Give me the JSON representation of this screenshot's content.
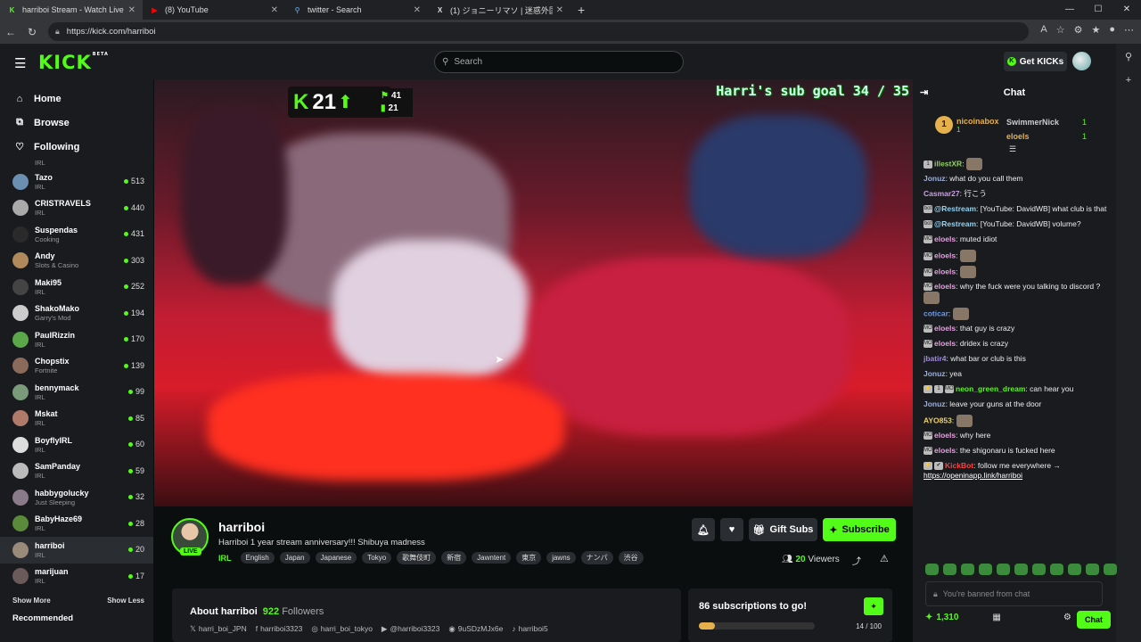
{
  "browser": {
    "tabs": [
      {
        "title": "harriboi Stream - Watch Live",
        "fav": "K",
        "fav_color": "#53fc18",
        "active": true
      },
      {
        "title": "(8) YouTube",
        "fav": "▶",
        "fav_color": "#ff0000",
        "active": false
      },
      {
        "title": "twitter - Search",
        "fav": "⚲",
        "fav_color": "#4a90d9",
        "active": false
      },
      {
        "title": "(1) ジョニーリマソ | 迷惑外国人撲滅",
        "fav": "X",
        "fav_color": "#dddddd",
        "active": false
      }
    ],
    "url": "https://kick.com/harriboi"
  },
  "header": {
    "logo": "KICK",
    "logo_beta": "BETA",
    "search_placeholder": "Search",
    "get_kicks_label": "Get KICKs"
  },
  "sidebar": {
    "nav": [
      {
        "label": "Home",
        "icon": "⌂"
      },
      {
        "label": "Browse",
        "icon": "⧉"
      },
      {
        "label": "Following",
        "icon": "♡"
      }
    ],
    "partial_category": "IRL",
    "channels": [
      {
        "name": "Tazo",
        "category": "IRL",
        "viewers": "513",
        "color": "#6a8fb0"
      },
      {
        "name": "CRISTRAVELS",
        "category": "IRL",
        "viewers": "440",
        "color": "#aaaaaa"
      },
      {
        "name": "Suspendas",
        "category": "Cooking",
        "viewers": "431",
        "color": "#2a2a2a"
      },
      {
        "name": "Andy",
        "category": "Slots & Casino",
        "viewers": "303",
        "color": "#b08a5a"
      },
      {
        "name": "Maki95",
        "category": "IRL",
        "viewers": "252",
        "color": "#444444"
      },
      {
        "name": "ShakoMako",
        "category": "Garry's Mod",
        "viewers": "194",
        "color": "#cccccc"
      },
      {
        "name": "PaulRizzin",
        "category": "IRL",
        "viewers": "170",
        "color": "#5aa84a"
      },
      {
        "name": "Chopstix",
        "category": "Fortnite",
        "viewers": "139",
        "color": "#8a6a5a"
      },
      {
        "name": "bennymack",
        "category": "IRL",
        "viewers": "99",
        "color": "#7a9a7a"
      },
      {
        "name": "Mskat",
        "category": "IRL",
        "viewers": "85",
        "color": "#b07a6a"
      },
      {
        "name": "BoyflyIRL",
        "category": "IRL",
        "viewers": "60",
        "color": "#dddddd"
      },
      {
        "name": "SamPanday",
        "category": "IRL",
        "viewers": "59",
        "color": "#bbbbbb"
      },
      {
        "name": "habbygolucky",
        "category": "Just Sleeping",
        "viewers": "32",
        "color": "#8a7a8a"
      },
      {
        "name": "BabyHaze69",
        "category": "IRL",
        "viewers": "28",
        "color": "#5a8a3a"
      },
      {
        "name": "harriboi",
        "category": "IRL",
        "viewers": "20",
        "color": "#9a8a7a",
        "selected": true
      },
      {
        "name": "marijuan",
        "category": "IRL",
        "viewers": "17",
        "color": "#6a5a5a"
      }
    ],
    "show_more": "Show More",
    "show_less": "Show Less",
    "recommended": "Recommended"
  },
  "video": {
    "kick_count": "21",
    "counter_top": "41",
    "counter_bottom": "21",
    "sub_goal": "Harri's sub goal 34 / 35"
  },
  "stream": {
    "streamer": "harriboi",
    "live_badge": "LIVE",
    "title": "Harriboi 1 year stream anniversary!!! Shibuya madness",
    "category": "IRL",
    "tags": [
      "English",
      "Japan",
      "Japanese",
      "Tokyo",
      "歌舞伎町",
      "新宿",
      "Jawntent",
      "東京",
      "jawns",
      "ナンパ",
      "渋谷"
    ],
    "gift_subs_label": "Gift Subs",
    "subscribe_label": "Subscribe",
    "viewers_count": "20",
    "viewers_label": "Viewers",
    "about_title": "About harriboi",
    "followers_count": "922",
    "followers_label": "Followers",
    "socials": [
      "harri_boi_JPN",
      "harriboi3323",
      "harri_boi_tokyo",
      "@harriboi3323",
      "9uSDzMJx6e",
      "harriboi5"
    ],
    "subs_to_go": "86 subscriptions to go!",
    "subs_progress_text": "14 / 100",
    "subs_progress": 0.14
  },
  "chat": {
    "title": "Chat",
    "top_gifter": {
      "rank": "1",
      "name": "nicoinabox",
      "count": "1"
    },
    "gifters": [
      {
        "name": "SwimmerNick",
        "count": "1",
        "color": "#cccccc"
      },
      {
        "name": "eloels",
        "count": "1",
        "color": "#e6b04c"
      }
    ],
    "messages": [
      {
        "badges": [
          "1"
        ],
        "user": "illestXR",
        "color": "#8fd35a",
        "text": "",
        "emote": true
      },
      {
        "badges": [],
        "user": "Jonuz",
        "color": "#9ab0e0",
        "text": "what do you call them"
      },
      {
        "badges": [],
        "user": "Casmar27",
        "color": "#c8a0e0",
        "text": "行こう"
      },
      {
        "badges": [
          "bot"
        ],
        "user": "@Restream",
        "color": "#8fd3f5",
        "text": "[YouTube: DavidWB] what club is that"
      },
      {
        "badges": [
          "bot"
        ],
        "user": "@Restream",
        "color": "#8fd3f5",
        "text": "[YouTube: DavidWB] volume?"
      },
      {
        "badges": [
          "MOD"
        ],
        "user": "eloels",
        "color": "#e6a0e0",
        "text": "muted idiot"
      },
      {
        "badges": [
          "MOD"
        ],
        "user": "eloels",
        "color": "#e6a0e0",
        "text": "",
        "emote": true
      },
      {
        "badges": [
          "MOD"
        ],
        "user": "eloels",
        "color": "#e6a0e0",
        "text": "",
        "emote": true
      },
      {
        "badges": [
          "MOD"
        ],
        "user": "eloels",
        "color": "#e6a0e0",
        "text": "why the fuck were you talking to discord ?",
        "emote": true
      },
      {
        "badges": [],
        "user": "coticar",
        "color": "#6a9af0",
        "text": "",
        "emote": true
      },
      {
        "badges": [
          "MOD"
        ],
        "user": "eloels",
        "color": "#e6a0e0",
        "text": "that guy is crazy"
      },
      {
        "badges": [
          "MOD"
        ],
        "user": "eloels",
        "color": "#e6a0e0",
        "text": "dridex is crazy"
      },
      {
        "badges": [],
        "user": "jbatir4",
        "color": "#a08ae0",
        "text": "what bar or club is this"
      },
      {
        "badges": [],
        "user": "Jonuz",
        "color": "#9ab0e0",
        "text": "yea"
      },
      {
        "badges": [
          "⚡",
          "1",
          "MOD"
        ],
        "user": "neon_green_dream",
        "color": "#53fc18",
        "text": "can hear you"
      },
      {
        "badges": [],
        "user": "Jonuz",
        "color": "#9ab0e0",
        "text": "leave your guns at the door"
      },
      {
        "badges": [],
        "user": "AYO853",
        "color": "#f0d060",
        "text": "",
        "emote": true
      },
      {
        "badges": [
          "MOD"
        ],
        "user": "eloels",
        "color": "#e6a0e0",
        "text": "why here"
      },
      {
        "badges": [
          "MOD"
        ],
        "user": "eloels",
        "color": "#e6a0e0",
        "text": "the shigonaru is fucked here"
      },
      {
        "badges": [
          "⚡",
          "✔"
        ],
        "user": "KickBot",
        "color": "#ff4040",
        "text": "follow me everywhere → ",
        "link": "https://openinapp.link/harriboi"
      }
    ],
    "input_placeholder": "You're banned from chat",
    "points": "1,310",
    "send_label": "Chat"
  }
}
